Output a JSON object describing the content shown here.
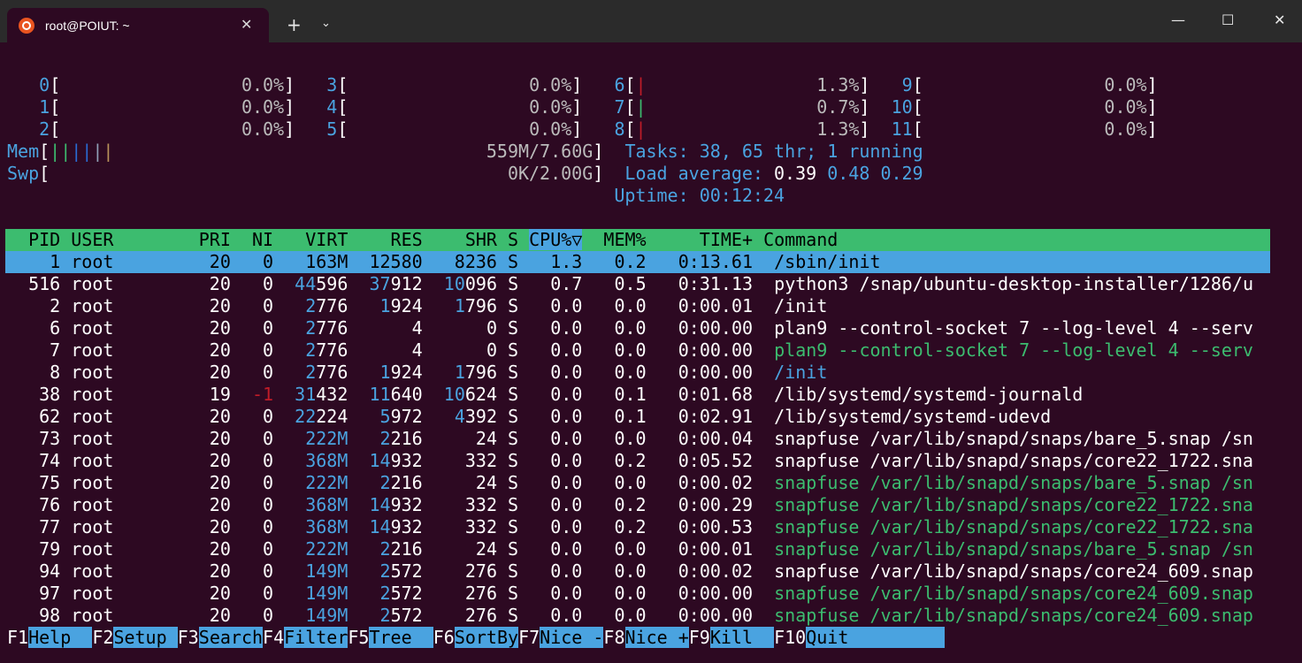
{
  "window": {
    "tab_title": "root@POIUT: ~",
    "tab_close": "✕",
    "new_tab": "+",
    "tab_menu": "⌄",
    "minimize": "—",
    "maximize": "☐",
    "close": "✕"
  },
  "meters": {
    "cpus": [
      {
        "id": "0",
        "value": "0.0%"
      },
      {
        "id": "1",
        "value": "0.0%"
      },
      {
        "id": "2",
        "value": "0.0%"
      },
      {
        "id": "3",
        "value": "0.0%"
      },
      {
        "id": "4",
        "value": "0.0%"
      },
      {
        "id": "5",
        "value": "0.0%"
      },
      {
        "id": "6",
        "value": "1.3%"
      },
      {
        "id": "7",
        "value": "0.7%"
      },
      {
        "id": "8",
        "value": "1.3%"
      },
      {
        "id": "9",
        "value": "0.0%"
      },
      {
        "id": "10",
        "value": "0.0%"
      },
      {
        "id": "11",
        "value": "0.0%"
      }
    ],
    "mem_label": "Mem",
    "mem_value": "559M/7.60G",
    "swp_label": "Swp",
    "swp_value": "0K/2.00G",
    "tasks_label": "Tasks:",
    "tasks_value": "38, 65 thr; 1 running",
    "load_label": "Load average:",
    "load_1": "0.39",
    "load_5": "0.48",
    "load_15": "0.29",
    "uptime_label": "Uptime:",
    "uptime_value": "00:12:24"
  },
  "table": {
    "columns": [
      "PID",
      "USER",
      "PRI",
      "NI",
      "VIRT",
      "RES",
      "SHR",
      "S",
      "CPU%▽",
      "MEM%",
      "TIME+",
      "Command"
    ],
    "rows": [
      {
        "pid": "1",
        "user": "root",
        "pri": "20",
        "ni": "0",
        "virt": "163M",
        "res": "12580",
        "shr": "8236",
        "s": "S",
        "cpu": "1.3",
        "mem": "0.2",
        "time": "0:13.61",
        "cmd": "/sbin/init"
      },
      {
        "pid": "516",
        "user": "root",
        "pri": "20",
        "ni": "0",
        "virt": "44596",
        "res": "37912",
        "shr": "10096",
        "s": "S",
        "cpu": "0.7",
        "mem": "0.5",
        "time": "0:31.13",
        "cmd": "python3 /snap/ubuntu-desktop-installer/1286/u"
      },
      {
        "pid": "2",
        "user": "root",
        "pri": "20",
        "ni": "0",
        "virt": "2776",
        "res": "1924",
        "shr": "1796",
        "s": "S",
        "cpu": "0.0",
        "mem": "0.0",
        "time": "0:00.01",
        "cmd": "/init"
      },
      {
        "pid": "6",
        "user": "root",
        "pri": "20",
        "ni": "0",
        "virt": "2776",
        "res": "4",
        "shr": "0",
        "s": "S",
        "cpu": "0.0",
        "mem": "0.0",
        "time": "0:00.00",
        "cmd": "plan9 --control-socket 7 --log-level 4 --serv"
      },
      {
        "pid": "7",
        "user": "root",
        "pri": "20",
        "ni": "0",
        "virt": "2776",
        "res": "4",
        "shr": "0",
        "s": "S",
        "cpu": "0.0",
        "mem": "0.0",
        "time": "0:00.00",
        "cmd": "plan9 --control-socket 7 --log-level 4 --serv"
      },
      {
        "pid": "8",
        "user": "root",
        "pri": "20",
        "ni": "0",
        "virt": "2776",
        "res": "1924",
        "shr": "1796",
        "s": "S",
        "cpu": "0.0",
        "mem": "0.0",
        "time": "0:00.00",
        "cmd": "/init"
      },
      {
        "pid": "38",
        "user": "root",
        "pri": "19",
        "ni": "-1",
        "virt": "31432",
        "res": "11640",
        "shr": "10624",
        "s": "S",
        "cpu": "0.0",
        "mem": "0.1",
        "time": "0:01.68",
        "cmd": "/lib/systemd/systemd-journald"
      },
      {
        "pid": "62",
        "user": "root",
        "pri": "20",
        "ni": "0",
        "virt": "22224",
        "res": "5972",
        "shr": "4392",
        "s": "S",
        "cpu": "0.0",
        "mem": "0.1",
        "time": "0:02.91",
        "cmd": "/lib/systemd/systemd-udevd"
      },
      {
        "pid": "73",
        "user": "root",
        "pri": "20",
        "ni": "0",
        "virt": "222M",
        "res": "2216",
        "shr": "24",
        "s": "S",
        "cpu": "0.0",
        "mem": "0.0",
        "time": "0:00.04",
        "cmd": "snapfuse /var/lib/snapd/snaps/bare_5.snap /sn"
      },
      {
        "pid": "74",
        "user": "root",
        "pri": "20",
        "ni": "0",
        "virt": "368M",
        "res": "14932",
        "shr": "332",
        "s": "S",
        "cpu": "0.0",
        "mem": "0.2",
        "time": "0:05.52",
        "cmd": "snapfuse /var/lib/snapd/snaps/core22_1722.sna"
      },
      {
        "pid": "75",
        "user": "root",
        "pri": "20",
        "ni": "0",
        "virt": "222M",
        "res": "2216",
        "shr": "24",
        "s": "S",
        "cpu": "0.0",
        "mem": "0.0",
        "time": "0:00.02",
        "cmd": "snapfuse /var/lib/snapd/snaps/bare_5.snap /sn"
      },
      {
        "pid": "76",
        "user": "root",
        "pri": "20",
        "ni": "0",
        "virt": "368M",
        "res": "14932",
        "shr": "332",
        "s": "S",
        "cpu": "0.0",
        "mem": "0.2",
        "time": "0:00.29",
        "cmd": "snapfuse /var/lib/snapd/snaps/core22_1722.sna"
      },
      {
        "pid": "77",
        "user": "root",
        "pri": "20",
        "ni": "0",
        "virt": "368M",
        "res": "14932",
        "shr": "332",
        "s": "S",
        "cpu": "0.0",
        "mem": "0.2",
        "time": "0:00.53",
        "cmd": "snapfuse /var/lib/snapd/snaps/core22_1722.sna"
      },
      {
        "pid": "79",
        "user": "root",
        "pri": "20",
        "ni": "0",
        "virt": "222M",
        "res": "2216",
        "shr": "24",
        "s": "S",
        "cpu": "0.0",
        "mem": "0.0",
        "time": "0:00.01",
        "cmd": "snapfuse /var/lib/snapd/snaps/bare_5.snap /sn"
      },
      {
        "pid": "94",
        "user": "root",
        "pri": "20",
        "ni": "0",
        "virt": "149M",
        "res": "2572",
        "shr": "276",
        "s": "S",
        "cpu": "0.0",
        "mem": "0.0",
        "time": "0:00.02",
        "cmd": "snapfuse /var/lib/snapd/snaps/core24_609.snap"
      },
      {
        "pid": "97",
        "user": "root",
        "pri": "20",
        "ni": "0",
        "virt": "149M",
        "res": "2572",
        "shr": "276",
        "s": "S",
        "cpu": "0.0",
        "mem": "0.0",
        "time": "0:00.00",
        "cmd": "snapfuse /var/lib/snapd/snaps/core24_609.snap"
      },
      {
        "pid": "98",
        "user": "root",
        "pri": "20",
        "ni": "0",
        "virt": "149M",
        "res": "2572",
        "shr": "276",
        "s": "S",
        "cpu": "0.0",
        "mem": "0.0",
        "time": "0:00.00",
        "cmd": "snapfuse /var/lib/snapd/snaps/core24_609.snap"
      }
    ]
  },
  "function_keys": [
    {
      "key": "F1",
      "label": "Help  "
    },
    {
      "key": "F2",
      "label": "Setup "
    },
    {
      "key": "F3",
      "label": "Search"
    },
    {
      "key": "F4",
      "label": "Filter"
    },
    {
      "key": "F5",
      "label": "Tree  "
    },
    {
      "key": "F6",
      "label": "SortBy"
    },
    {
      "key": "F7",
      "label": "Nice -"
    },
    {
      "key": "F8",
      "label": "Nice +"
    },
    {
      "key": "F9",
      "label": "Kill  "
    },
    {
      "key": "F10",
      "label": "Quit  "
    }
  ],
  "colors": {
    "background": "#2d0922",
    "header_bar": "#3cbc6f",
    "selected_row": "#4aa3e0",
    "cyan_text": "#4aa3e0",
    "green_text": "#3cbc6f",
    "red_text": "#c01c28"
  }
}
